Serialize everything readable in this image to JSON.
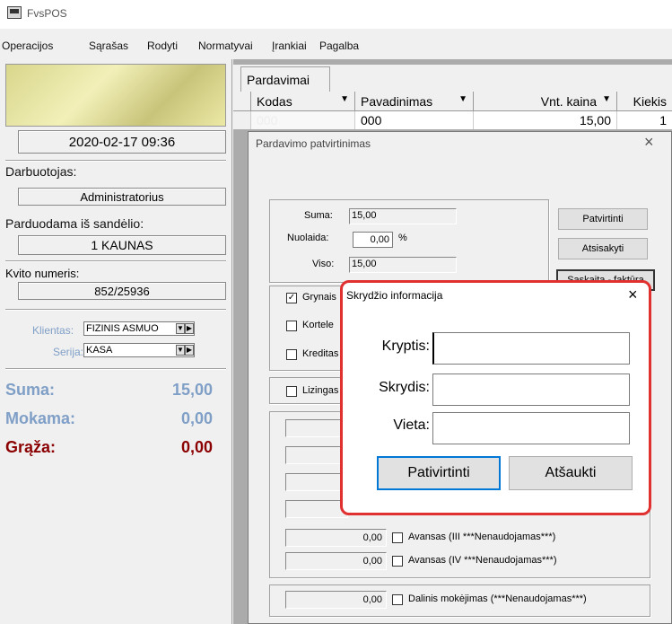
{
  "app": {
    "title": "FvsPOS"
  },
  "menu": [
    "Operacijos",
    "Sąrašas",
    "Rodyti",
    "Normatyvai",
    "Įrankiai",
    "Pagalba"
  ],
  "left": {
    "datetime": "2020-02-17 09:36",
    "employee_label": "Darbuotojas:",
    "employee": "Administratorius",
    "warehouse_label": "Parduodama iš sandėlio:",
    "warehouse": "1 KAUNAS",
    "receipt_label": "Kvito numeris:",
    "receipt": "852/25936",
    "client_label": "Klientas:",
    "client": "FIZINIS ASMUO",
    "series_label": "Serija:",
    "series": "KASA",
    "suma_label": "Suma:",
    "suma": "15,00",
    "mokama_label": "Mokama:",
    "mokama": "0,00",
    "graza_label": "Grąža:",
    "graza": "0,00",
    "colors": {
      "blue": "#7f9fc7",
      "red": "#8b0000"
    }
  },
  "grid": {
    "tab": "Pardavimai",
    "columns": [
      "Kodas",
      "Pavadinimas",
      "Vnt. kaina",
      "Kiekis"
    ],
    "row": {
      "kodas": "000",
      "pavadinimas": "000",
      "kaina": "15,00",
      "kiekis": "1"
    }
  },
  "confirm_dialog": {
    "title": "Pardavimo patvirtinimas",
    "suma_label": "Suma:",
    "suma": "15,00",
    "nuolaida_label": "Nuolaida:",
    "nuolaida": "0,00",
    "percent": "%",
    "viso_label": "Viso:",
    "viso": "15,00",
    "btn_confirm": "Patvirtinti",
    "btn_cancel": "Atsisakyti",
    "btn_invoice": "Sąskaita - faktūra",
    "checkboxes": [
      "Grynais",
      "Kortele",
      "Kreditas"
    ],
    "lizing": "Lizingas",
    "advance_rows": [
      {
        "value": "0,00",
        "label": "Avansas (III ***Nenaudojamas***)"
      },
      {
        "value": "0,00",
        "label": "Avansas (IV ***Nenaudojamas***)"
      }
    ],
    "partial": {
      "value": "0,00",
      "label": "Dalinis mokėjimas (***Nenaudojamas***)"
    }
  },
  "credit_dialog": {
    "title": "Skrydžio informacija",
    "fields": [
      {
        "label": "Kryptis:",
        "value": ""
      },
      {
        "label": "Skrydis:",
        "value": ""
      },
      {
        "label": "Vieta:",
        "value": ""
      }
    ],
    "btn_confirm": "Pativirtinti",
    "btn_cancel": "Atšaukti"
  }
}
